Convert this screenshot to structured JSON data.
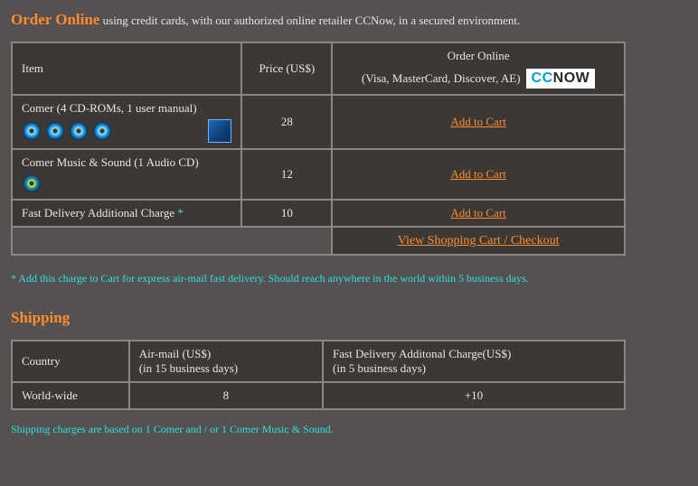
{
  "intro": {
    "heading": "Order Online",
    "text": "using credit cards, with our authorized online retailer CCNow, in a secured environment."
  },
  "order_table": {
    "headers": {
      "item": "Item",
      "price": "Price (US$)",
      "order_line1": "Order Online",
      "order_line2": "(Visa, MasterCard, Discover, AE)",
      "badge_cc": "CC",
      "badge_now": "NOW"
    },
    "rows": [
      {
        "item": "Comer (4 CD-ROMs, 1 user manual)",
        "price": "28",
        "action": "Add to Cart",
        "cd_count": 4,
        "show_thumb": true
      },
      {
        "item": "Comer Music & Sound (1 Audio CD)",
        "price": "12",
        "action": "Add to Cart",
        "cd_count": 1,
        "show_thumb": false
      },
      {
        "item": "Fast Delivery Additional Charge",
        "price": "10",
        "action": "Add to Cart",
        "asterisk": "*",
        "cd_count": 0,
        "show_thumb": false
      }
    ],
    "view_cart": "View Shopping Cart  /  Checkout"
  },
  "footnote": "* Add this charge to Cart for express air-mail fast delivery. Should reach anywhere in the world within 5 business days.",
  "shipping": {
    "heading": "Shipping",
    "headers": {
      "country": "Country",
      "air_l1": "Air-mail (US$)",
      "air_l2": "(in 15 business days)",
      "fast_l1": "Fast Delivery Additonal Charge(US$)",
      "fast_l2": "(in 5 business days)"
    },
    "row": {
      "country": "World-wide",
      "air": "8",
      "fast": "+10"
    },
    "note": "Shipping charges are based on 1 Comer and / or 1 Comer Music & Sound."
  }
}
